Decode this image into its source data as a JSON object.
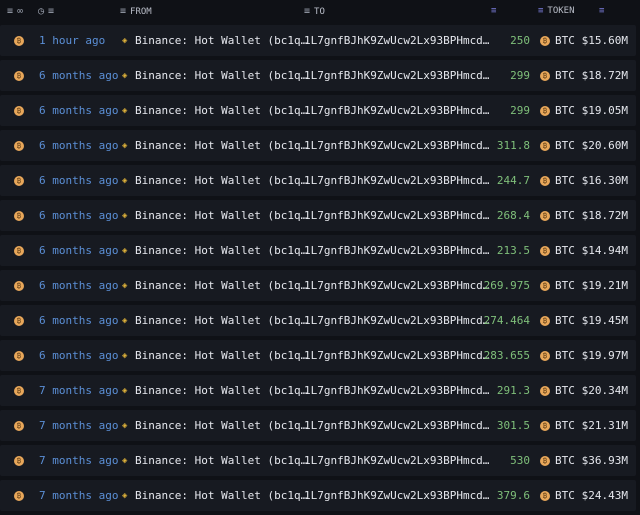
{
  "header": {
    "from": "FROM",
    "to": "TO",
    "token": "TOKEN"
  },
  "colors": {
    "time": "#5b8fd6",
    "amount": "#7fbf7a",
    "btc": "#e8a75a",
    "filter": "#7c7fe0"
  },
  "rows": [
    {
      "time": "1 hour ago",
      "from": "Binance: Hot Wallet (bc1q…",
      "to": "1L7gnfBJhK9ZwUcw2Lx93BPHmcd…",
      "amount": "250",
      "token": "BTC",
      "usd": "$15.60M"
    },
    {
      "time": "6 months ago",
      "from": "Binance: Hot Wallet (bc1q…",
      "to": "1L7gnfBJhK9ZwUcw2Lx93BPHmcd…",
      "amount": "299",
      "token": "BTC",
      "usd": "$18.72M"
    },
    {
      "time": "6 months ago",
      "from": "Binance: Hot Wallet (bc1q…",
      "to": "1L7gnfBJhK9ZwUcw2Lx93BPHmcd…",
      "amount": "299",
      "token": "BTC",
      "usd": "$19.05M"
    },
    {
      "time": "6 months ago",
      "from": "Binance: Hot Wallet (bc1q…",
      "to": "1L7gnfBJhK9ZwUcw2Lx93BPHmcd…",
      "amount": "311.8",
      "token": "BTC",
      "usd": "$20.60M"
    },
    {
      "time": "6 months ago",
      "from": "Binance: Hot Wallet (bc1q…",
      "to": "1L7gnfBJhK9ZwUcw2Lx93BPHmcd…",
      "amount": "244.7",
      "token": "BTC",
      "usd": "$16.30M"
    },
    {
      "time": "6 months ago",
      "from": "Binance: Hot Wallet (bc1q…",
      "to": "1L7gnfBJhK9ZwUcw2Lx93BPHmcd…",
      "amount": "268.4",
      "token": "BTC",
      "usd": "$18.72M"
    },
    {
      "time": "6 months ago",
      "from": "Binance: Hot Wallet (bc1q…",
      "to": "1L7gnfBJhK9ZwUcw2Lx93BPHmcd…",
      "amount": "213.5",
      "token": "BTC",
      "usd": "$14.94M"
    },
    {
      "time": "6 months ago",
      "from": "Binance: Hot Wallet (bc1q…",
      "to": "1L7gnfBJhK9ZwUcw2Lx93BPHmcd…",
      "amount": "269.975",
      "token": "BTC",
      "usd": "$19.21M"
    },
    {
      "time": "6 months ago",
      "from": "Binance: Hot Wallet (bc1q…",
      "to": "1L7gnfBJhK9ZwUcw2Lx93BPHmcd…",
      "amount": "274.464",
      "token": "BTC",
      "usd": "$19.45M"
    },
    {
      "time": "6 months ago",
      "from": "Binance: Hot Wallet (bc1q…",
      "to": "1L7gnfBJhK9ZwUcw2Lx93BPHmcd…",
      "amount": "283.655",
      "token": "BTC",
      "usd": "$19.97M"
    },
    {
      "time": "7 months ago",
      "from": "Binance: Hot Wallet (bc1q…",
      "to": "1L7gnfBJhK9ZwUcw2Lx93BPHmcd…",
      "amount": "291.3",
      "token": "BTC",
      "usd": "$20.34M"
    },
    {
      "time": "7 months ago",
      "from": "Binance: Hot Wallet (bc1q…",
      "to": "1L7gnfBJhK9ZwUcw2Lx93BPHmcd…",
      "amount": "301.5",
      "token": "BTC",
      "usd": "$21.31M"
    },
    {
      "time": "7 months ago",
      "from": "Binance: Hot Wallet (bc1q…",
      "to": "1L7gnfBJhK9ZwUcw2Lx93BPHmcd…",
      "amount": "530",
      "token": "BTC",
      "usd": "$36.93M"
    },
    {
      "time": "7 months ago",
      "from": "Binance: Hot Wallet (bc1q…",
      "to": "1L7gnfBJhK9ZwUcw2Lx93BPHmcd…",
      "amount": "379.6",
      "token": "BTC",
      "usd": "$24.43M"
    }
  ]
}
